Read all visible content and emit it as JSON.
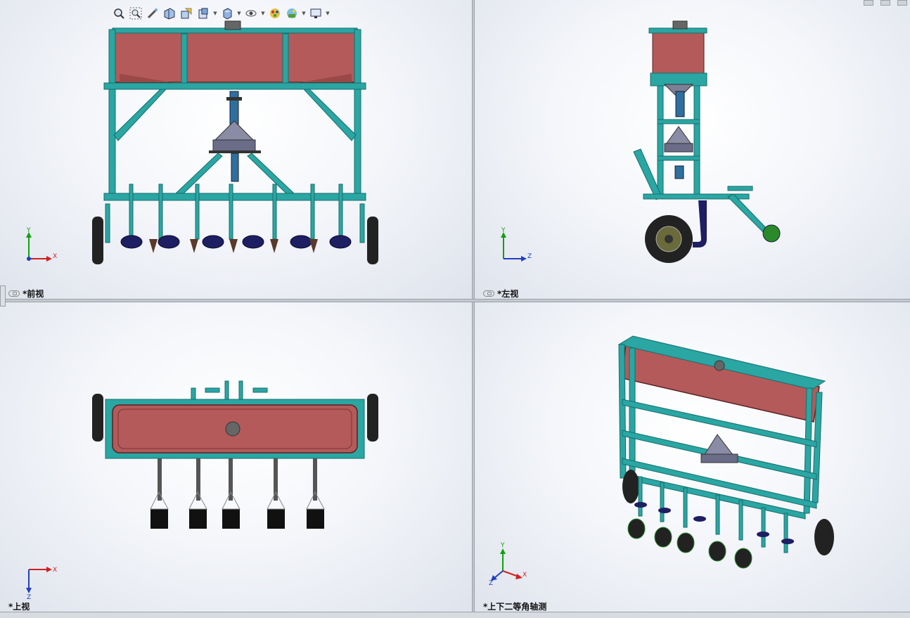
{
  "viewports": {
    "front": {
      "label": "*前视"
    },
    "left": {
      "label": "*左视"
    },
    "top": {
      "label": "*上视"
    },
    "iso": {
      "label": "*上下二等角轴测"
    }
  },
  "triad_axes": {
    "front": {
      "a": "Y",
      "b": "X"
    },
    "left": {
      "a": "Y",
      "b": "Z"
    },
    "top": {
      "a": "X",
      "b": "Z"
    },
    "iso": {
      "a": "Y",
      "b": "X",
      "c": "Z"
    }
  },
  "toolbar": {
    "icons": [
      "zoom-to-fit-icon",
      "zoom-to-area-icon",
      "previous-view-icon",
      "section-view-icon",
      "dynamic-annotation-icon",
      "view-orientation-icon",
      "display-style-icon",
      "hide-show-items-icon",
      "edit-appearance-icon",
      "apply-scene-icon",
      "view-settings-icon"
    ]
  },
  "colors": {
    "frame": "#2aa6a3",
    "frame_dark": "#156e6c",
    "hopper": "#b45a5a",
    "hopper_dark": "#7a3434",
    "metal": "#7d7f96",
    "blade": "#1e1e63",
    "tire": "#222222"
  }
}
